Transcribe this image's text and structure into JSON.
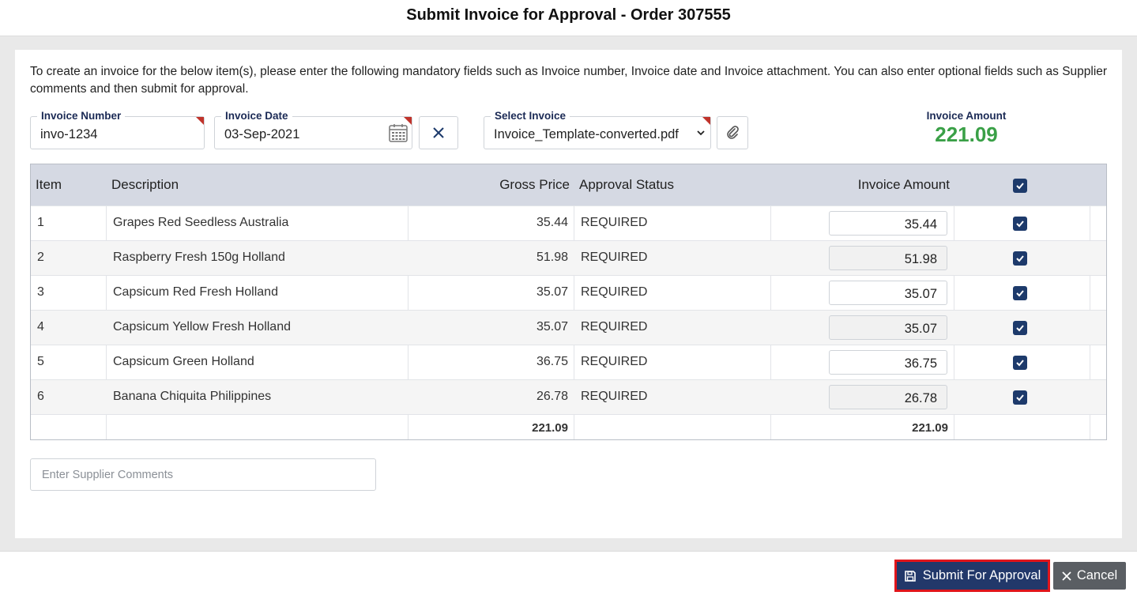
{
  "dialog": {
    "title": "Submit Invoice for Approval - Order 307555",
    "intro": "To create an invoice for the below item(s), please enter the following mandatory fields such as Invoice number, Invoice date and Invoice attachment. You can also enter optional fields such as Supplier comments and then submit for approval."
  },
  "form": {
    "invoice_number": {
      "label": "Invoice Number",
      "value": "invo-1234"
    },
    "invoice_date": {
      "label": "Invoice Date",
      "value": "03-Sep-2021"
    },
    "select_invoice": {
      "label": "Select Invoice",
      "value": "Invoice_Template-converted.pdf"
    },
    "invoice_amount": {
      "label": "Invoice Amount",
      "value": "221.09"
    }
  },
  "table": {
    "headers": {
      "item": "Item",
      "description": "Description",
      "gross_price": "Gross Price",
      "approval_status": "Approval Status",
      "invoice_amount": "Invoice Amount"
    },
    "rows": [
      {
        "item": "1",
        "description": "Grapes Red Seedless Australia",
        "gross_price": "35.44",
        "status": "REQUIRED",
        "amount": "35.44",
        "checked": true
      },
      {
        "item": "2",
        "description": "Raspberry Fresh 150g Holland",
        "gross_price": "51.98",
        "status": "REQUIRED",
        "amount": "51.98",
        "checked": true
      },
      {
        "item": "3",
        "description": "Capsicum Red Fresh Holland",
        "gross_price": "35.07",
        "status": "REQUIRED",
        "amount": "35.07",
        "checked": true
      },
      {
        "item": "4",
        "description": "Capsicum Yellow Fresh Holland",
        "gross_price": "35.07",
        "status": "REQUIRED",
        "amount": "35.07",
        "checked": true
      },
      {
        "item": "5",
        "description": "Capsicum Green Holland",
        "gross_price": "36.75",
        "status": "REQUIRED",
        "amount": "36.75",
        "checked": true
      },
      {
        "item": "6",
        "description": "Banana Chiquita Philippines",
        "gross_price": "26.78",
        "status": "REQUIRED",
        "amount": "26.78",
        "checked": true
      }
    ],
    "totals": {
      "gross_price": "221.09",
      "invoice_amount": "221.09"
    }
  },
  "comments": {
    "placeholder": "Enter Supplier Comments"
  },
  "footer": {
    "submit_label": "Submit For Approval",
    "cancel_label": "Cancel"
  },
  "colors": {
    "primary": "#22386a",
    "accent_green": "#3aa047",
    "highlight_red": "#e0151b",
    "header_bg": "#d5d9e3"
  }
}
